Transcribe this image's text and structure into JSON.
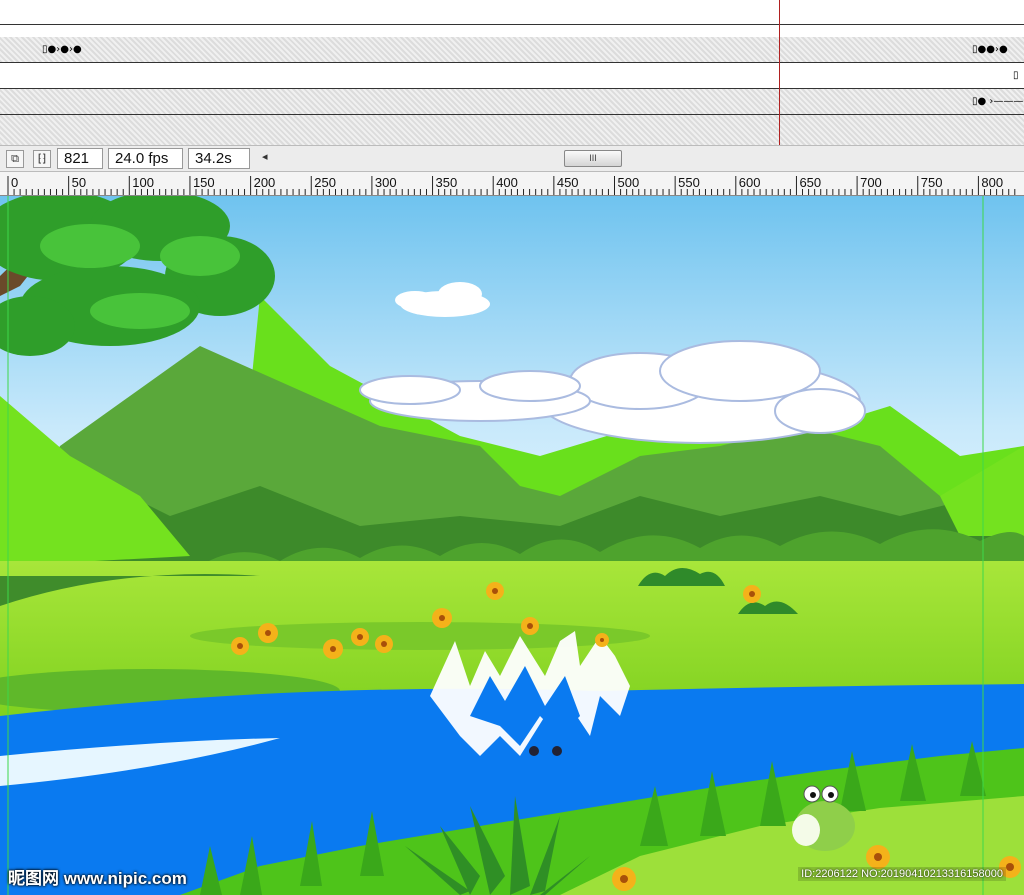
{
  "timeline": {
    "top_labels": [
      "·",
      "· ·",
      "· · ·"
    ]
  },
  "statusbar": {
    "frame": "821",
    "fps": "24.0 fps",
    "time": "34.2s",
    "scroll_arrow": "◂",
    "scroll_thumb": "III"
  },
  "ruler": {
    "labels": [
      "0",
      "50",
      "100",
      "150",
      "200",
      "250",
      "300",
      "350",
      "400",
      "450",
      "500",
      "550",
      "600",
      "650",
      "700",
      "750",
      "800"
    ]
  },
  "watermark": {
    "site": "昵图网 www.nipic.com",
    "id": "ID:2206122 NO:20190410213316158000"
  },
  "colors": {
    "sky_top": "#7cc8f0",
    "sky_bottom": "#e8f5fc",
    "river": "#0a7af0",
    "grass": "#8fdc2a",
    "mountain_dark": "#3d8a2a",
    "mountain_light": "#6ee11f"
  }
}
